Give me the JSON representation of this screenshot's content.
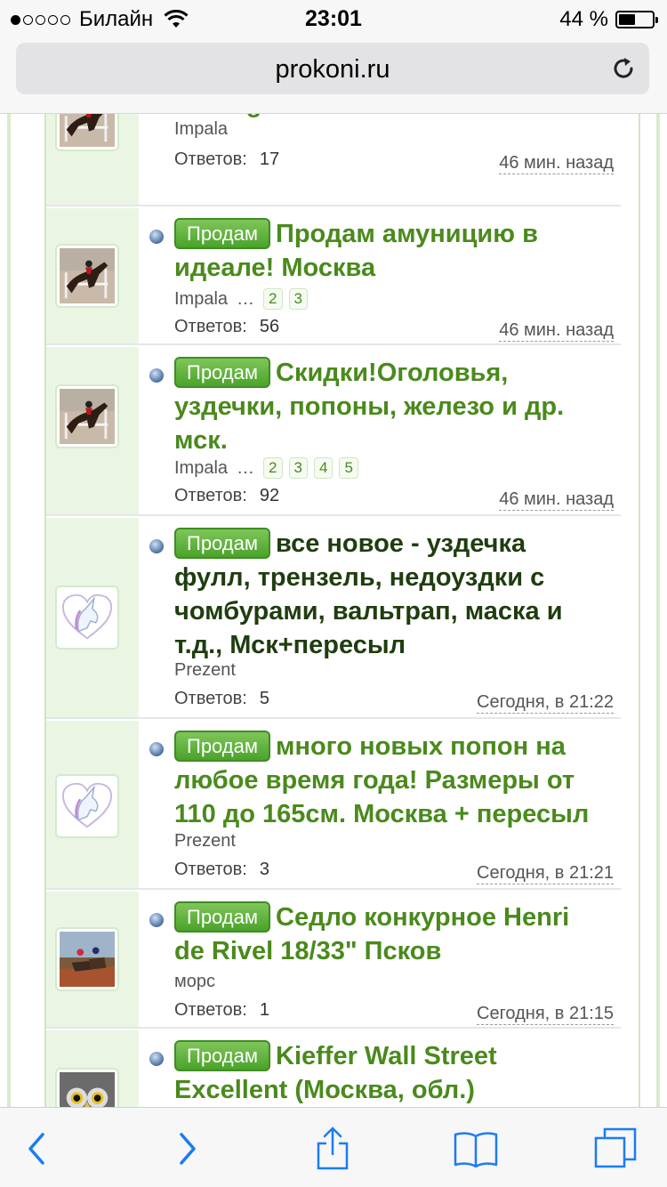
{
  "status_bar": {
    "carrier": "Билайн",
    "time": "23:01",
    "battery_percent": "44 %",
    "battery_level": 0.44
  },
  "browser": {
    "url": "prokoni.ru"
  },
  "topics": [
    {
      "tag": "",
      "title": "Prestige Москва",
      "author": "Impala",
      "pages": [],
      "replies_label": "Ответов:",
      "replies": "17",
      "time": "46 мин. назад",
      "avatar": "horse-jump-avatar"
    },
    {
      "tag": "Продам",
      "title": "Продам амуницию в идеале! Москва",
      "author": "Impala",
      "pages": [
        "2",
        "3"
      ],
      "replies_label": "Ответов:",
      "replies": "56",
      "time": "46 мин. назад",
      "avatar": "horse-jump-avatar"
    },
    {
      "tag": "Продам",
      "title": "Скидки!Оголовья, уздечки, попоны, железо и др. мск.",
      "author": "Impala",
      "pages": [
        "2",
        "3",
        "4",
        "5"
      ],
      "replies_label": "Ответов:",
      "replies": "92",
      "time": "46 мин. назад",
      "avatar": "horse-jump-avatar"
    },
    {
      "tag": "Продам",
      "title": "все новое - уздечка фулл, трензель, недоуздки с чомбурами, вальтрап, маска и т.д., Мск+пересыл",
      "author": "Prezent",
      "pages": [],
      "replies_label": "Ответов:",
      "replies": "5",
      "time": "Сегодня, в 21:22",
      "avatar": "unicorn-heart-avatar"
    },
    {
      "tag": "Продам",
      "title": "много новых попон на любое время года! Размеры от 110 до 165см. Москва + пересыл",
      "author": "Prezent",
      "pages": [],
      "replies_label": "Ответов:",
      "replies": "3",
      "time": "Сегодня, в 21:21",
      "avatar": "unicorn-heart-avatar"
    },
    {
      "tag": "Продам",
      "title": "Седло конкурное Henri de Rivel 18/33\" Псков",
      "author": "морс",
      "pages": [],
      "replies_label": "Ответов:",
      "replies": "1",
      "time": "Сегодня, в 21:15",
      "avatar": "riders-field-avatar"
    },
    {
      "tag": "Продам",
      "title": "Kieffer Wall Street Excellent (Москва, обл.)",
      "author": "",
      "pages": [],
      "replies_label": "",
      "replies": "",
      "time": "",
      "avatar": "owl-avatar"
    }
  ],
  "toolbar": {
    "icons": [
      "back-icon",
      "forward-icon",
      "share-icon",
      "bookmarks-icon",
      "tabs-icon"
    ]
  },
  "colors": {
    "title_green": "#4a8a1c",
    "tag_green": "#4aa32a",
    "panel_bg": "#eaf6e3"
  }
}
